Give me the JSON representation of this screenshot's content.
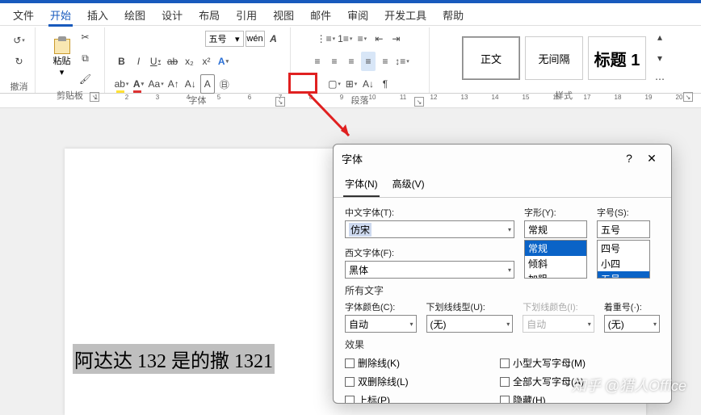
{
  "menu": {
    "tabs": [
      "文件",
      "开始",
      "插入",
      "绘图",
      "设计",
      "布局",
      "引用",
      "视图",
      "邮件",
      "审阅",
      "开发工具",
      "帮助"
    ],
    "active": 1
  },
  "ribbon": {
    "undo": "撤消",
    "clipboard": {
      "paste": "粘贴",
      "label": "剪贴板"
    },
    "font": {
      "size": "五号",
      "wen": "wén",
      "aA": "A",
      "bold": "B",
      "italic": "I",
      "underline": "U",
      "strike": "ab",
      "sub": "x₂",
      "sup": "x²",
      "label": "字体"
    },
    "paragraph": {
      "label": "段落"
    },
    "styles": {
      "items": [
        "正文",
        "无间隔",
        "标题 1"
      ],
      "label": "样式"
    }
  },
  "doc": {
    "sampleText": "阿达达 132 是的撒 1321"
  },
  "dialog": {
    "title": "字体",
    "help": "?",
    "close": "✕",
    "tabs": [
      "字体(N)",
      "高级(V)"
    ],
    "chineseFontLabel": "中文字体(T):",
    "chineseFont": "仿宋",
    "westernFontLabel": "西文字体(F):",
    "westernFont": "黑体",
    "styleLabel": "字形(Y):",
    "style": "常规",
    "styleOptions": [
      "常规",
      "倾斜",
      "加粗"
    ],
    "sizeLabel": "字号(S):",
    "size": "五号",
    "sizeOptions": [
      "四号",
      "小四",
      "五号"
    ],
    "allTextLabel": "所有文字",
    "fontColorLabel": "字体颜色(C):",
    "fontColor": "自动",
    "underlineLabel": "下划线线型(U):",
    "underline": "(无)",
    "underlineColorLabel": "下划线颜色(I):",
    "underlineColor": "自动",
    "emphasisLabel": "着重号(·):",
    "emphasis": "(无)",
    "effectsLabel": "效果",
    "effects": [
      "删除线(K)",
      "双删除线(L)",
      "上标(P)"
    ],
    "effectsRight": [
      "小型大写字母(M)",
      "全部大写字母(A)",
      "隐藏(H)"
    ]
  },
  "watermark": "知乎 @猎人Office"
}
